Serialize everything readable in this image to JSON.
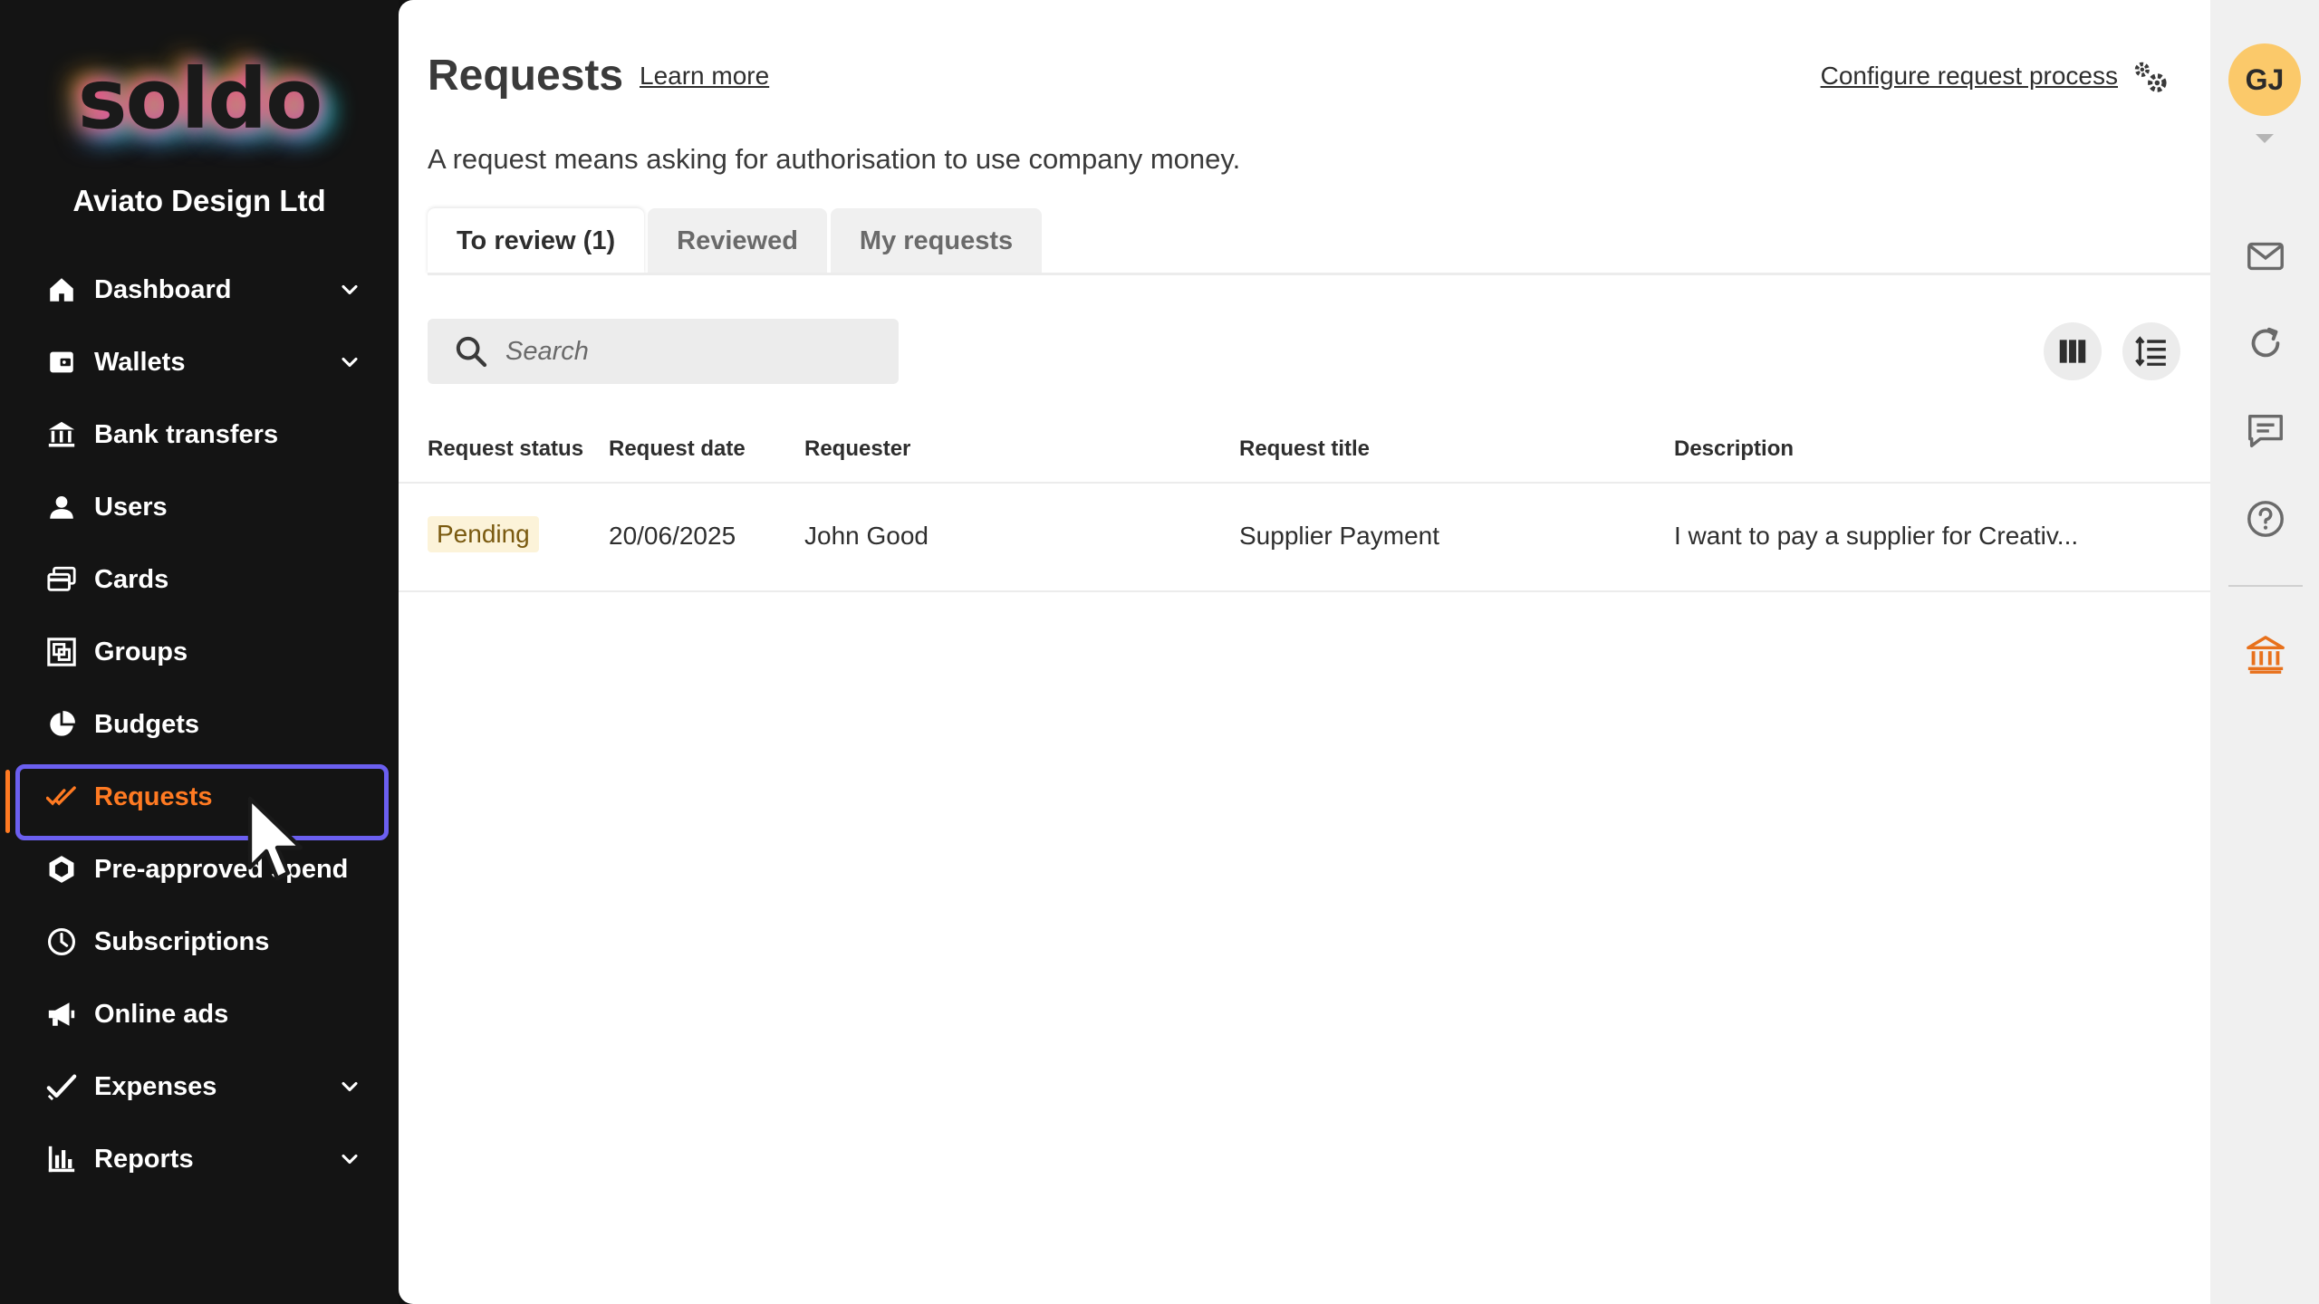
{
  "brand": {
    "logo_text": "soldo",
    "org_name": "Aviato Design Ltd"
  },
  "sidebar": {
    "items": [
      {
        "label": "Dashboard",
        "icon": "home-icon",
        "has_chevron": true
      },
      {
        "label": "Wallets",
        "icon": "wallet-icon",
        "has_chevron": true
      },
      {
        "label": "Bank transfers",
        "icon": "bank-transfer-icon",
        "has_chevron": false
      },
      {
        "label": "Users",
        "icon": "user-icon",
        "has_chevron": false
      },
      {
        "label": "Cards",
        "icon": "cards-icon",
        "has_chevron": false
      },
      {
        "label": "Groups",
        "icon": "groups-icon",
        "has_chevron": false
      },
      {
        "label": "Budgets",
        "icon": "pie-chart-icon",
        "has_chevron": false
      },
      {
        "label": "Requests",
        "icon": "double-check-icon",
        "has_chevron": false,
        "active": true
      },
      {
        "label": "Pre-approved spend",
        "icon": "hexagon-icon",
        "has_chevron": false
      },
      {
        "label": "Subscriptions",
        "icon": "clock-icon",
        "has_chevron": false
      },
      {
        "label": "Online ads",
        "icon": "megaphone-icon",
        "has_chevron": false
      },
      {
        "label": "Expenses",
        "icon": "check-icon",
        "has_chevron": true
      },
      {
        "label": "Reports",
        "icon": "bar-chart-icon",
        "has_chevron": true
      }
    ]
  },
  "header": {
    "title": "Requests",
    "learn_more": "Learn more",
    "configure": "Configure request process",
    "subtitle": "A request means asking for authorisation to use company money."
  },
  "tabs": [
    {
      "label": "To review (1)",
      "active": true
    },
    {
      "label": "Reviewed",
      "active": false
    },
    {
      "label": "My requests",
      "active": false
    }
  ],
  "search": {
    "placeholder": "Search",
    "value": ""
  },
  "table": {
    "columns": [
      "Request status",
      "Request date",
      "Requester",
      "Request title",
      "Description"
    ],
    "rows": [
      {
        "status": "Pending",
        "date": "20/06/2025",
        "requester": "John Good",
        "title": "Supplier Payment",
        "description": "I want to pay a supplier for Creativ..."
      }
    ]
  },
  "rail": {
    "avatar_initials": "GJ"
  },
  "colors": {
    "accent": "#ff7a22",
    "focus_ring": "#6b5ff0",
    "pending_bg": "#fcf3d9",
    "avatar_bg": "#fbc96a",
    "bank_icon": "#e8711c"
  }
}
